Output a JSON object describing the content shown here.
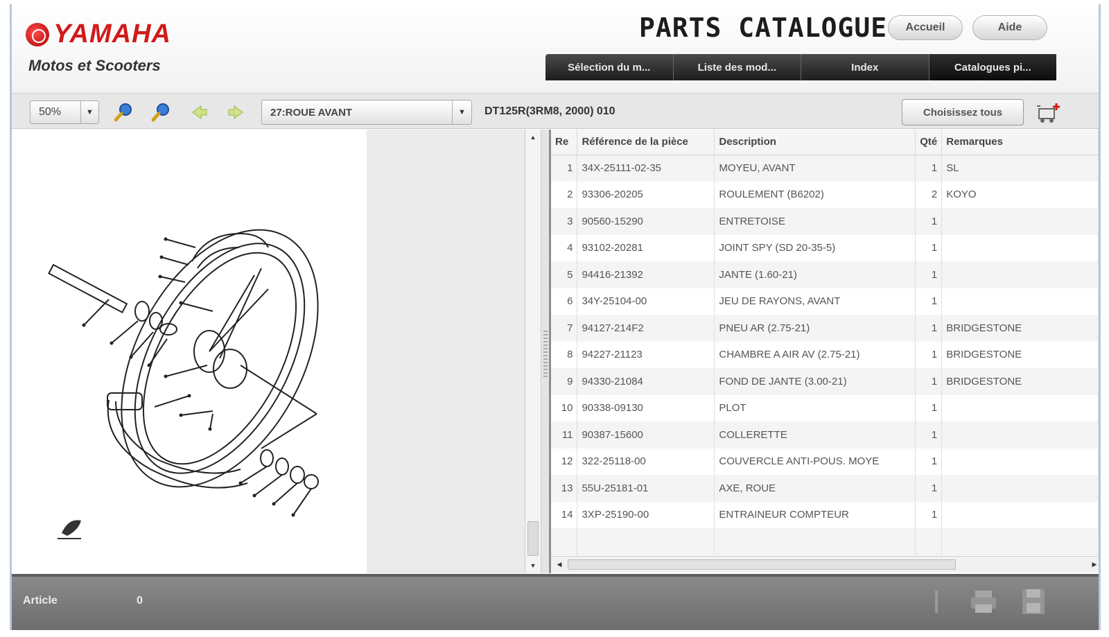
{
  "header": {
    "brand": "YAMAHA",
    "subtitle": "Motos et Scooters",
    "catalogue_title": "PARTS CATALOGUE",
    "accueil_label": "Accueil",
    "aide_label": "Aide",
    "tabs": [
      {
        "label": "Sélection du m..."
      },
      {
        "label": "Liste des mod..."
      },
      {
        "label": "Index"
      },
      {
        "label": "Catalogues pi..."
      }
    ]
  },
  "toolbar": {
    "zoom_value": "50%",
    "section_value": "27:ROUE AVANT",
    "model_code": "DT125R(3RM8, 2000) 010",
    "choose_all_label": "Choisissez tous"
  },
  "table": {
    "columns": [
      "Re",
      "Référence de la pièce",
      "Description",
      "Qté",
      "Remarques"
    ],
    "rows": [
      {
        "no": "1",
        "ref": "34X-25111-02-35",
        "desc": "MOYEU, AVANT",
        "qty": "1",
        "remark": "SL"
      },
      {
        "no": "2",
        "ref": "93306-20205",
        "desc": "ROULEMENT (B6202)",
        "qty": "2",
        "remark": "KOYO"
      },
      {
        "no": "3",
        "ref": "90560-15290",
        "desc": "ENTRETOISE",
        "qty": "1",
        "remark": ""
      },
      {
        "no": "4",
        "ref": "93102-20281",
        "desc": "JOINT SPY (SD 20-35-5)",
        "qty": "1",
        "remark": ""
      },
      {
        "no": "5",
        "ref": "94416-21392",
        "desc": "JANTE (1.60-21)",
        "qty": "1",
        "remark": ""
      },
      {
        "no": "6",
        "ref": "34Y-25104-00",
        "desc": "JEU DE RAYONS, AVANT",
        "qty": "1",
        "remark": ""
      },
      {
        "no": "7",
        "ref": "94127-214F2",
        "desc": "PNEU AR (2.75-21)",
        "qty": "1",
        "remark": "BRIDGESTONE"
      },
      {
        "no": "8",
        "ref": "94227-21123",
        "desc": "CHAMBRE A AIR AV (2.75-21)",
        "qty": "1",
        "remark": "BRIDGESTONE"
      },
      {
        "no": "9",
        "ref": "94330-21084",
        "desc": "FOND DE JANTE (3.00-21)",
        "qty": "1",
        "remark": "BRIDGESTONE"
      },
      {
        "no": "10",
        "ref": "90338-09130",
        "desc": "PLOT",
        "qty": "1",
        "remark": ""
      },
      {
        "no": "11",
        "ref": "90387-15600",
        "desc": "COLLERETTE",
        "qty": "1",
        "remark": ""
      },
      {
        "no": "12",
        "ref": "322-25118-00",
        "desc": "COUVERCLE ANTI-POUS. MOYE",
        "qty": "1",
        "remark": ""
      },
      {
        "no": "13",
        "ref": "55U-25181-01",
        "desc": "AXE, ROUE",
        "qty": "1",
        "remark": ""
      },
      {
        "no": "14",
        "ref": "3XP-25190-00",
        "desc": "ENTRAINEUR COMPTEUR",
        "qty": "1",
        "remark": ""
      }
    ]
  },
  "footer": {
    "label": "Article",
    "count": "0"
  },
  "colors": {
    "brand_red": "#d21a1a",
    "tabbar_dark": "#1d1d1d",
    "footer_gray": "#7a7a7a"
  }
}
